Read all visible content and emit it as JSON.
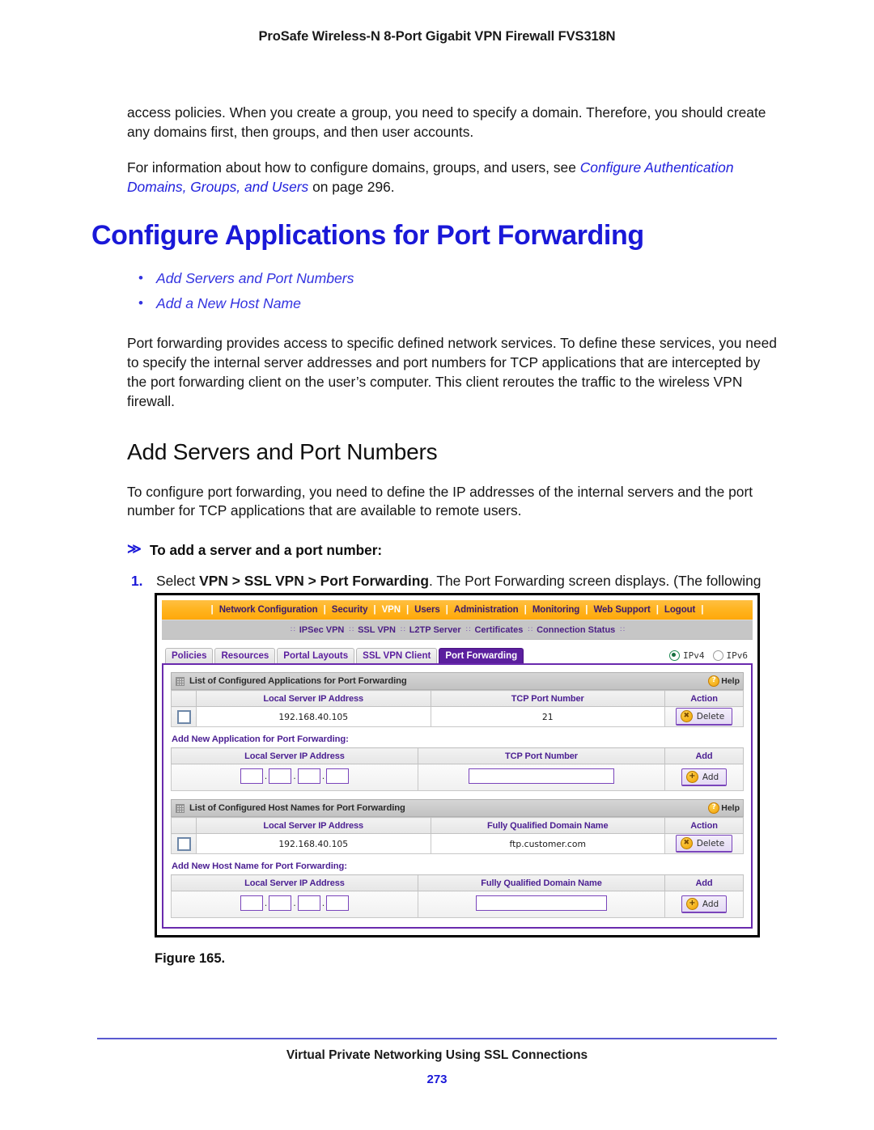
{
  "running_head": "ProSafe Wireless-N 8-Port Gigabit VPN Firewall FVS318N",
  "body": {
    "para1": "access policies. When you create a group, you need to specify a domain. Therefore, you should create any domains first, then groups, and then user accounts.",
    "para2_prefix": "For information about how to configure domains, groups, and users, see ",
    "para2_xref": "Configure Authentication Domains, Groups, and Users",
    "para2_suffix": " on page 296.",
    "chapter_heading": "Configure Applications for Port Forwarding",
    "links": [
      {
        "bullet": "•",
        "label": "Add Servers and Port Numbers"
      },
      {
        "bullet": "•",
        "label": "Add a New Host Name"
      }
    ],
    "para3": "Port forwarding provides access to specific defined network services. To define these services, you need to specify the internal server addresses and port numbers for TCP applications that are intercepted by the port forwarding client on the user’s computer. This client reroutes the traffic to the wireless VPN firewall.",
    "section_heading": "Add Servers and Port Numbers",
    "para4": "To configure port forwarding, you need to define the IP addresses of the internal servers and the port number for TCP applications that are available to remote users.",
    "procedure_chevron": "≫",
    "procedure_heading": "To add a server and a port number:",
    "step1": {
      "num": "1.",
      "text_a": "Select ",
      "bold_b": "VPN > SSL VPN > Port Forwarding",
      "text_c": ". The Port Forwarding screen displays. (The following figure shows an example.)"
    }
  },
  "figure": {
    "caption": "Figure 165.",
    "nav_main": {
      "separator": "|",
      "items": [
        {
          "label": "Network Configuration",
          "active": false
        },
        {
          "label": "Security",
          "active": false
        },
        {
          "label": "VPN",
          "active": true
        },
        {
          "label": "Users",
          "active": false
        },
        {
          "label": "Administration",
          "active": false
        },
        {
          "label": "Monitoring",
          "active": false
        },
        {
          "label": "Web Support",
          "active": false
        },
        {
          "label": "Logout",
          "active": false
        }
      ]
    },
    "nav_sub": {
      "separator": "∷",
      "items": [
        "IPSec VPN",
        "SSL VPN",
        "L2TP Server",
        "Certificates",
        "Connection Status"
      ]
    },
    "tabs": [
      {
        "label": "Policies",
        "active": false
      },
      {
        "label": "Resources",
        "active": false
      },
      {
        "label": "Portal Layouts",
        "active": false
      },
      {
        "label": "SSL VPN Client",
        "active": false
      },
      {
        "label": "Port Forwarding",
        "active": true
      }
    ],
    "ip_toggle": {
      "ipv4_label": "IPv4",
      "ipv6_label": "IPv6",
      "selected": "IPv4"
    },
    "help_label": "Help",
    "help_glyph": "?",
    "section_apps": {
      "title": "List of Configured Applications for Port Forwarding",
      "headers": [
        "",
        "Local Server IP Address",
        "TCP Port Number",
        "Action"
      ],
      "rows": [
        {
          "ip": "192.168.40.105",
          "port": "21",
          "action": "Delete"
        }
      ],
      "delete_glyph": "✖"
    },
    "add_app": {
      "label": "Add New Application for Port Forwarding:",
      "headers": [
        "Local Server IP Address",
        "TCP Port Number",
        "Add"
      ],
      "octet_separator": ".",
      "octets": [
        "",
        "",
        "",
        ""
      ],
      "port_value": "",
      "add_label": "Add",
      "add_glyph": "+"
    },
    "section_hosts": {
      "title": "List of Configured Host Names for Port Forwarding",
      "headers": [
        "",
        "Local Server IP Address",
        "Fully Qualified Domain Name",
        "Action"
      ],
      "rows": [
        {
          "ip": "192.168.40.105",
          "fqdn": "ftp.customer.com",
          "action": "Delete"
        }
      ]
    },
    "add_host": {
      "label": "Add New Host Name for Port Forwarding:",
      "headers": [
        "Local Server IP Address",
        "Fully Qualified Domain Name",
        "Add"
      ],
      "octets": [
        "",
        "",
        "",
        ""
      ],
      "fqdn_value": "",
      "add_label": "Add"
    }
  },
  "footer": {
    "title": "Virtual Private Networking Using SSL Connections",
    "page_number": "273"
  },
  "colors": {
    "link_blue": "#2222dd",
    "heading_blue": "#1a18d8",
    "nav_orange": "#ffb521",
    "tab_purple": "#5b1f9e",
    "panel_purple": "#6a2aae",
    "header_purple": "#4b1f92"
  }
}
